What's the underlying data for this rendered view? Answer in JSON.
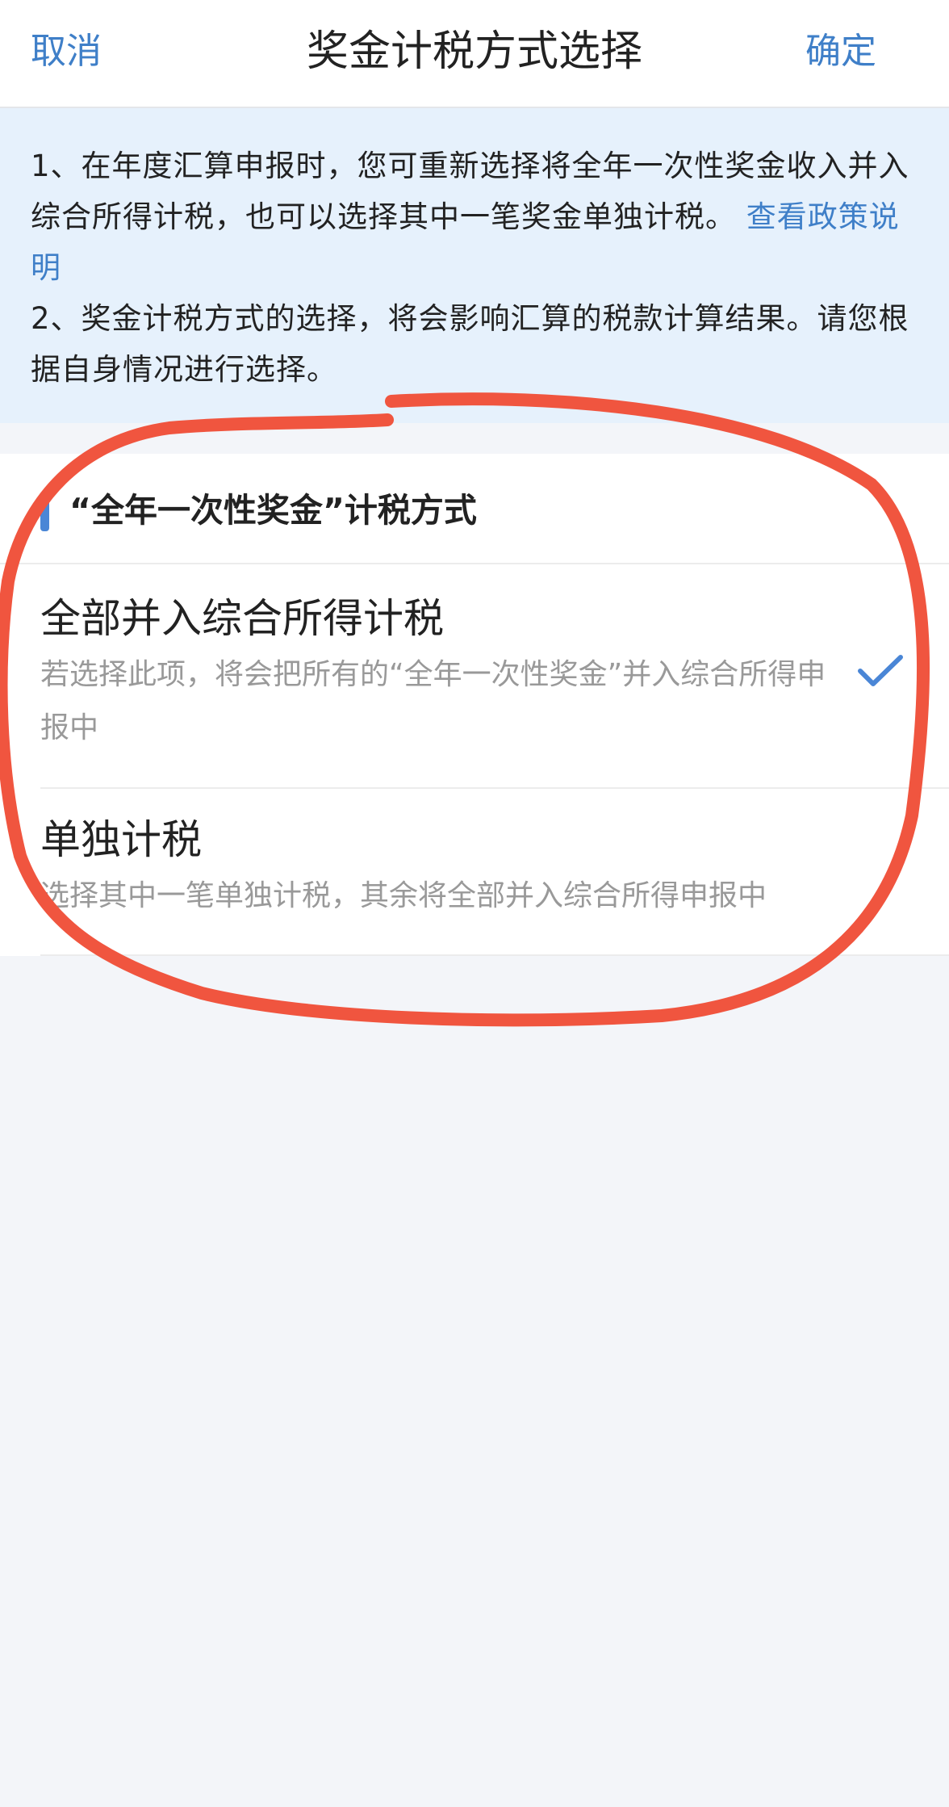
{
  "navbar": {
    "cancel_label": "取消",
    "title": "奖金计税方式选择",
    "confirm_label": "确定"
  },
  "notice": {
    "line1_text": "1、在年度汇算申报时，您可重新选择将全年一次性奖金收入并入综合所得计税，也可以选择其中一笔奖金单独计税。",
    "line1_link": "查看政策说明",
    "line2_text": "2、奖金计税方式的选择，将会影响汇算的税款计算结果。请您根据自身情况进行选择。"
  },
  "section": {
    "title": "“全年一次性奖金”计税方式",
    "accent_color": "#4a86d6"
  },
  "options": [
    {
      "title": "全部并入综合所得计税",
      "description": "若选择此项，将会把所有的“全年一次性奖金”并入综合所得申报中",
      "selected": true,
      "icon": "checkmark-icon"
    },
    {
      "title": "单独计税",
      "description": "选择其中一笔单独计税，其余将全部并入综合所得申报中",
      "selected": false
    }
  ],
  "colors": {
    "link_blue": "#3f7fc8",
    "notice_bg": "#e6f1fc",
    "page_bg": "#f3f5f9",
    "annotation_red": "#f0553f"
  }
}
